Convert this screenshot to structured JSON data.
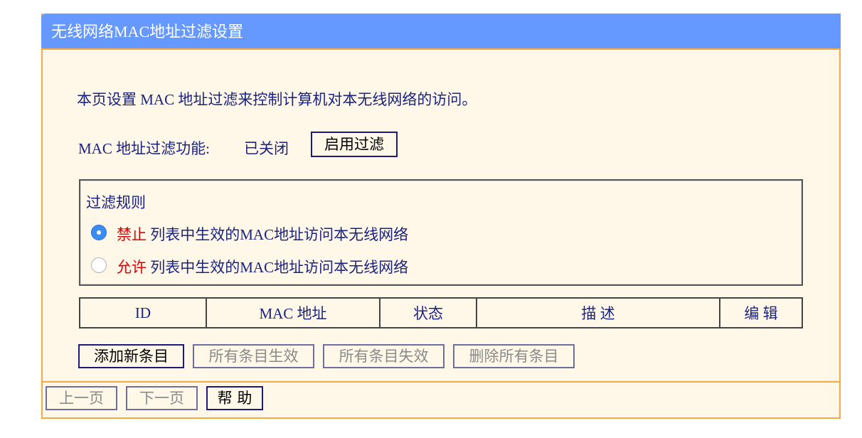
{
  "title": "无线网络MAC地址过滤设置",
  "description": "本页设置 MAC 地址过滤来控制计算机对本无线网络的访问。",
  "filter_status": {
    "label": "MAC 地址过滤功能:",
    "value": "已关闭",
    "enable_button": "启用过滤"
  },
  "rules": {
    "legend": "过滤规则",
    "options": [
      {
        "keyword": "禁止",
        "text": "列表中生效的MAC地址访问本无线网络",
        "selected": true
      },
      {
        "keyword": "允许",
        "text": "列表中生效的MAC地址访问本无线网络",
        "selected": false
      }
    ]
  },
  "table": {
    "headers": [
      "ID",
      "MAC 地址",
      "状态",
      "描 述",
      "编 辑"
    ],
    "rows": []
  },
  "actions": {
    "add": "添加新条目",
    "enable_all": "所有条目生效",
    "disable_all": "所有条目失效",
    "delete_all": "删除所有条目"
  },
  "nav": {
    "prev": "上一页",
    "next": "下一页",
    "help": "帮 助"
  },
  "colors": {
    "title_bar": "#6699ff",
    "border": "#f7a744",
    "background": "#fff8e8",
    "text": "#1a237e",
    "highlight": "#e00000"
  }
}
